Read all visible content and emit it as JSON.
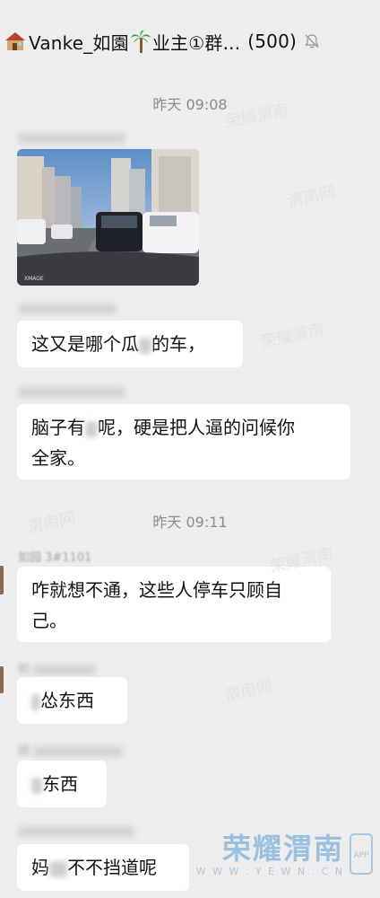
{
  "header": {
    "title": "Vanke_如園",
    "title_suffix": "业主①群...",
    "member_count": "(500)"
  },
  "messages": {
    "ts1": "昨天 09:08",
    "ts2": "昨天 09:11",
    "m2_text": "这又是哪个瓜",
    "m2_text_tail": "的车，",
    "m3_text_a": "脑子有",
    "m3_text_b": "呢，硬是把人逼的问候你",
    "m3_text_c": "全家。",
    "m4_sender": "如园 3#1101",
    "m4_text_a": "咋就想不通，这些人停车只顾自",
    "m4_text_b": "己。",
    "m5_sender": "如",
    "m5_text": "怂东西",
    "m6_sender": "团",
    "m6_text": "东西",
    "m7_text_a": "妈",
    "m7_text_b": "不不挡道呢"
  },
  "photo": {
    "caption": "XMAGE"
  },
  "watermark": {
    "brand": "荣耀渭南",
    "url": "W W W . Y E W N . C N",
    "app": "APP"
  },
  "colors": {
    "background": "#ededed",
    "bubble": "#ffffff",
    "timestamp": "#8c8c8c"
  },
  "icons": [
    "house-icon",
    "palm-tree-icon",
    "mute-bell-icon"
  ]
}
